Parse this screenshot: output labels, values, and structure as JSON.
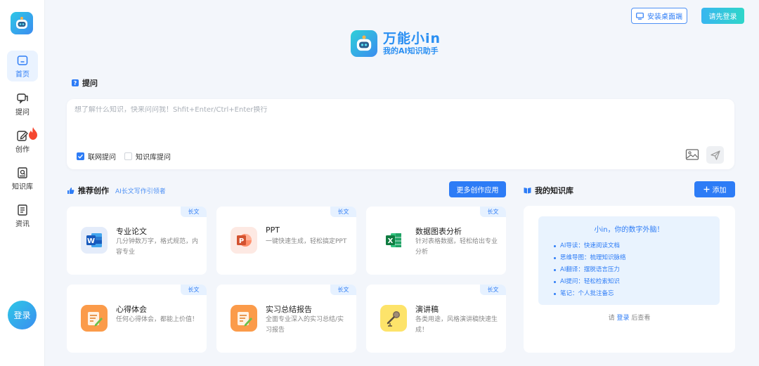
{
  "sidebar": {
    "items": [
      {
        "label": "首页",
        "icon": "home-icon",
        "active": true
      },
      {
        "label": "提问",
        "icon": "chat-icon"
      },
      {
        "label": "创作",
        "icon": "edit-icon",
        "hot": true
      },
      {
        "label": "知识库",
        "icon": "book-icon"
      },
      {
        "label": "资讯",
        "icon": "news-icon"
      }
    ],
    "login_label": "登录"
  },
  "header": {
    "install_label": "安装桌面端",
    "login_label": "请先登录"
  },
  "brand": {
    "name": "万能小in",
    "slogan": "我的AI知识助手"
  },
  "ask": {
    "title": "提问",
    "placeholder": "想了解什么知识，快来问问我！Shfit+Enter/Ctrl+Enter换行",
    "option_web": "联网提问",
    "option_kb": "知识库提问"
  },
  "create": {
    "title": "推荐创作",
    "subtitle": "AI长文写作引领者",
    "more_label": "更多创作应用",
    "cards": [
      {
        "tag": "长文",
        "title": "专业论文",
        "desc": "几分钟数万字，格式规范，内容专业",
        "icon": "word-icon"
      },
      {
        "tag": "长文",
        "title": "PPT",
        "desc": "一键快速生成，轻松搞定PPT",
        "icon": "ppt-icon"
      },
      {
        "tag": "长文",
        "title": "数据图表分析",
        "desc": "针对表格数据，轻松给出专业分析",
        "icon": "excel-icon"
      },
      {
        "tag": "长文",
        "title": "心得体会",
        "desc": "任何心得体会，都能上价值！",
        "icon": "notepad-icon"
      },
      {
        "tag": "长文",
        "title": "实习总结报告",
        "desc": "全面专业深入的实习总结/实习报告",
        "icon": "notepad-icon"
      },
      {
        "tag": "长文",
        "title": "演讲稿",
        "desc": "各类用途，风格演讲稿快速生成！",
        "icon": "microphone-icon"
      }
    ]
  },
  "knowledge": {
    "title": "我的知识库",
    "add_label": "添加",
    "intro": "小in，你的数字外脑！",
    "features": [
      "AI导读：快速阅读文档",
      "思维导图：梳理知识脉络",
      "AI翻译：摆脱语言压力",
      "AI提问：轻松检索知识",
      "笔记：个人批注备忘"
    ],
    "footer_prefix": "请",
    "footer_link": "登录",
    "footer_suffix": "后查看"
  },
  "colors": {
    "accent": "#2d7cf6",
    "brand_gradient_start": "#2ec7e6",
    "brand_gradient_end": "#3c8cf0",
    "hot": "#f5462f"
  }
}
